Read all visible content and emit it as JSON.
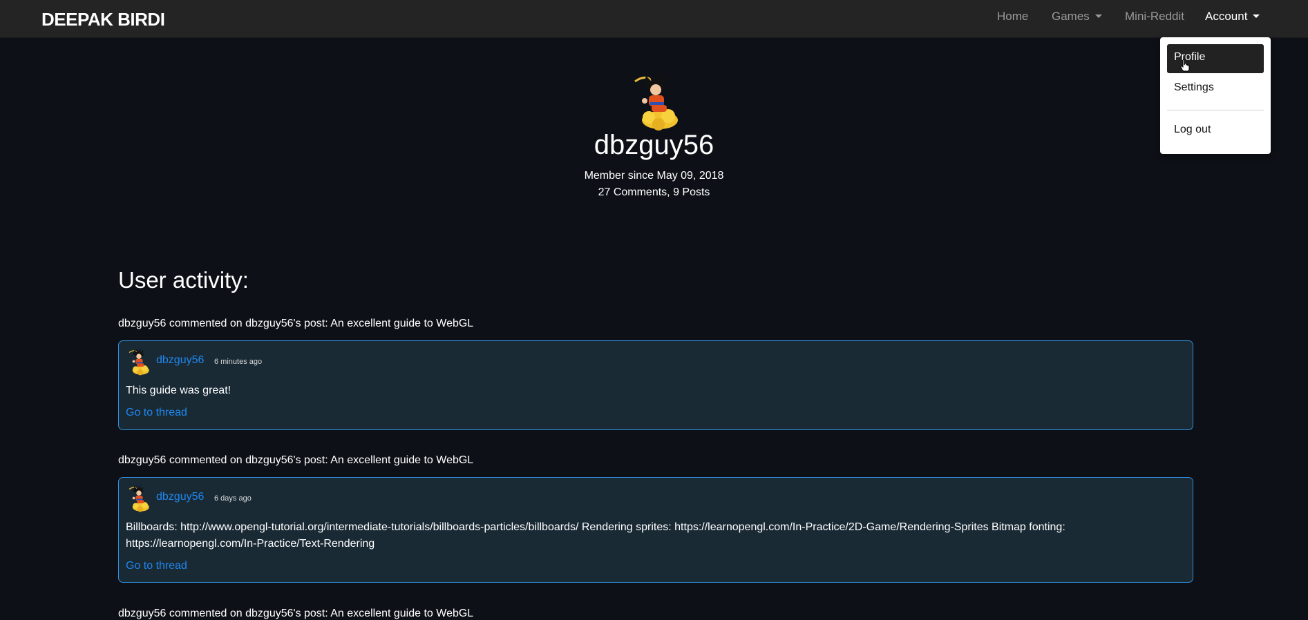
{
  "navbar": {
    "brand": "DEEPAK BIRDI",
    "links": {
      "home": "Home",
      "games": "Games",
      "mini_reddit": "Mini-Reddit",
      "account": "Account"
    }
  },
  "account_menu": {
    "items": {
      "profile": "Profile",
      "settings": "Settings",
      "logout": "Log out"
    },
    "active": "Profile"
  },
  "profile": {
    "username": "dbzguy56",
    "avatar_icon": "goku-on-cloud-avatar",
    "member_since": "Member since May 09, 2018",
    "stats": "27 Comments, 9 Posts"
  },
  "activity": {
    "title": "User activity:",
    "entries": [
      {
        "summary": "dbzguy56 commented on dbzguy56's post: An excellent guide to WebGL",
        "user": "dbzguy56",
        "time": "6 minutes ago",
        "body": "This guide was great!",
        "link": "Go to thread"
      },
      {
        "summary": "dbzguy56 commented on dbzguy56's post: An excellent guide to WebGL",
        "user": "dbzguy56",
        "time": "6 days ago",
        "body": "Billboards: http://www.opengl-tutorial.org/intermediate-tutorials/billboards-particles/billboards/ Rendering sprites: https://learnopengl.com/In-Practice/2D-Game/Rendering-Sprites Bitmap fonting: https://learnopengl.com/In-Practice/Text-Rendering",
        "link": "Go to thread"
      },
      {
        "summary": "dbzguy56 commented on dbzguy56's post: An excellent guide to WebGL"
      }
    ]
  },
  "colors": {
    "background": "#0d1117",
    "navbar": "#242424",
    "card_bg": "#1a2a35",
    "card_border": "#2f8fdd",
    "link": "#1e88f0"
  }
}
